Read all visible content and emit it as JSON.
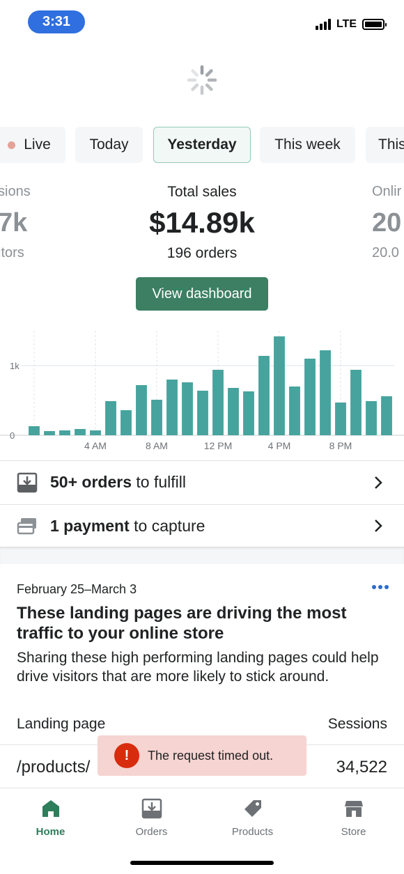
{
  "status_bar": {
    "time": "3:31",
    "network": "LTE"
  },
  "tabs": [
    {
      "label": "Live",
      "active": false
    },
    {
      "label": "Today",
      "active": false
    },
    {
      "label": "Yesterday",
      "active": true
    },
    {
      "label": "This week",
      "active": false
    },
    {
      "label": "This",
      "active": false
    }
  ],
  "metrics": {
    "left": {
      "label": "sions",
      "value": "7k",
      "sub": "itors"
    },
    "center": {
      "label": "Total sales",
      "value": "$14.89k",
      "sub": "196 orders"
    },
    "right": {
      "label": "Onlir",
      "value": "20",
      "sub": "20.0"
    }
  },
  "view_dashboard_label": "View dashboard",
  "chart_data": {
    "type": "bar",
    "ylabel_ticks": [
      "0",
      "1k"
    ],
    "ylim": [
      0,
      1500
    ],
    "x_tick_labels": [
      "4 AM",
      "8 AM",
      "12 PM",
      "4 PM",
      "8 PM"
    ],
    "categories": [
      "12 AM",
      "1 AM",
      "2 AM",
      "3 AM",
      "4 AM",
      "5 AM",
      "6 AM",
      "7 AM",
      "8 AM",
      "9 AM",
      "10 AM",
      "11 AM",
      "12 PM",
      "1 PM",
      "2 PM",
      "3 PM",
      "4 PM",
      "5 PM",
      "6 PM",
      "7 PM",
      "8 PM",
      "9 PM",
      "10 PM",
      "11 PM"
    ],
    "values": [
      130,
      60,
      70,
      90,
      70,
      490,
      360,
      720,
      510,
      800,
      760,
      640,
      940,
      680,
      630,
      1140,
      1420,
      700,
      1100,
      1220,
      470,
      940,
      490,
      560
    ],
    "color": "#47a39d"
  },
  "tasks": [
    {
      "bold": "50+ orders",
      "rest": " to fulfill",
      "icon": "inbox-download-icon"
    },
    {
      "bold": "1 payment",
      "rest": " to capture",
      "icon": "credit-card-icon"
    }
  ],
  "insight_card": {
    "date_range": "February 25–March 3",
    "title": "These landing pages are driving the most traffic to your online store",
    "description": "Sharing these high performing landing pages could help drive visitors that are more likely to stick around.",
    "col_landing": "Landing page",
    "col_sessions": "Sessions",
    "row_page": "/products/",
    "row_sessions": "34,522"
  },
  "toast": {
    "message": "The request timed out."
  },
  "bottom_nav": [
    {
      "label": "Home",
      "icon": "home-icon",
      "active": true
    },
    {
      "label": "Orders",
      "icon": "orders-icon",
      "active": false
    },
    {
      "label": "Products",
      "icon": "tag-icon",
      "active": false
    },
    {
      "label": "Store",
      "icon": "store-icon",
      "active": false
    }
  ]
}
